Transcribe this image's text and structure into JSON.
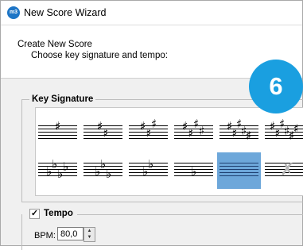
{
  "window": {
    "title": "New Score Wizard",
    "app_icon_text": "m3"
  },
  "header": {
    "title": "Create New Score",
    "subtitle": "Choose key signature and tempo:"
  },
  "step_badge": "6",
  "key_signature": {
    "label": "Key Signature",
    "rows": [
      [
        {
          "accidental": "sharp",
          "count": 1
        },
        {
          "accidental": "sharp",
          "count": 2
        },
        {
          "accidental": "sharp",
          "count": 3
        },
        {
          "accidental": "sharp",
          "count": 4
        },
        {
          "accidental": "sharp",
          "count": 5
        },
        {
          "accidental": "sharp",
          "count": 6
        }
      ],
      [
        {
          "accidental": "flat",
          "count": 4
        },
        {
          "accidental": "flat",
          "count": 3
        },
        {
          "accidental": "flat",
          "count": 2
        },
        {
          "accidental": "flat",
          "count": 1
        },
        {
          "accidental": "none",
          "count": 0,
          "selected": true
        },
        {
          "accidental": "none",
          "count": 0,
          "atonal": true
        }
      ]
    ],
    "glyphs": {
      "sharp": "♯",
      "flat": "♭",
      "atonal": "♮"
    }
  },
  "tempo": {
    "label": "Tempo",
    "checked": true,
    "check_glyph": "✓",
    "bpm_label": "BPM:",
    "bpm_value": "80,0"
  },
  "colors": {
    "selected_tile": "#6da7da",
    "badge": "#1a9fe0",
    "app_icon": "#1d75c6"
  }
}
